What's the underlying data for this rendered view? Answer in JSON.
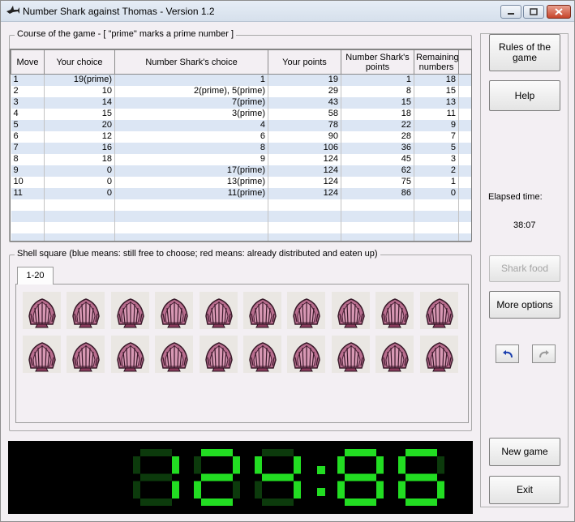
{
  "window": {
    "title": "Number Shark against Thomas - Version 1.2",
    "controls": {
      "minimize": "▭",
      "maximize": "□",
      "close": "✕"
    }
  },
  "course": {
    "label": "Course of the game -  [ \"prime\" marks a prime number ]",
    "headers": [
      "Move",
      "Your choice",
      "Number Shark's choice",
      "Your points",
      "Number Shark's points",
      "Remaining numbers"
    ],
    "rows": [
      [
        "1",
        "19(prime)",
        "1",
        "19",
        "1",
        "18"
      ],
      [
        "2",
        "10",
        "2(prime), 5(prime)",
        "29",
        "8",
        "15"
      ],
      [
        "3",
        "14",
        "7(prime)",
        "43",
        "15",
        "13"
      ],
      [
        "4",
        "15",
        "3(prime)",
        "58",
        "18",
        "11"
      ],
      [
        "5",
        "20",
        "4",
        "78",
        "22",
        "9"
      ],
      [
        "6",
        "12",
        "6",
        "90",
        "28",
        "7"
      ],
      [
        "7",
        "16",
        "8",
        "106",
        "36",
        "5"
      ],
      [
        "8",
        "18",
        "9",
        "124",
        "45",
        "3"
      ],
      [
        "9",
        "0",
        "17(prime)",
        "124",
        "62",
        "2"
      ],
      [
        "10",
        "0",
        "13(prime)",
        "124",
        "75",
        "1"
      ],
      [
        "11",
        "0",
        "11(prime)",
        "124",
        "86",
        "0"
      ]
    ],
    "empty_rows": 4
  },
  "shells": {
    "label": "Shell square  (blue means: still free to choose;  red means: already distributed and eaten up)",
    "tab": "1-20",
    "count": 20,
    "state": "eaten",
    "icon": "scallop-shell-icon"
  },
  "score_display": {
    "player": "124",
    "shark": "86",
    "separator": ":",
    "color": "#22dd22"
  },
  "sidebar": {
    "rules_button": "Rules of the game",
    "help_button": "Help",
    "elapsed_label": "Elapsed time:",
    "elapsed_value": "38:07",
    "shark_food_button": "Shark food",
    "more_options_button": "More options",
    "undo_icon": "undo-arrow-icon",
    "redo_icon": "redo-arrow-icon",
    "new_game_button": "New game",
    "exit_button": "Exit"
  },
  "colors": {
    "row_alt": "#dce6f4",
    "led_on": "#22dd22",
    "led_off": "#0c3a0c",
    "shell": "#8a3c5c"
  }
}
